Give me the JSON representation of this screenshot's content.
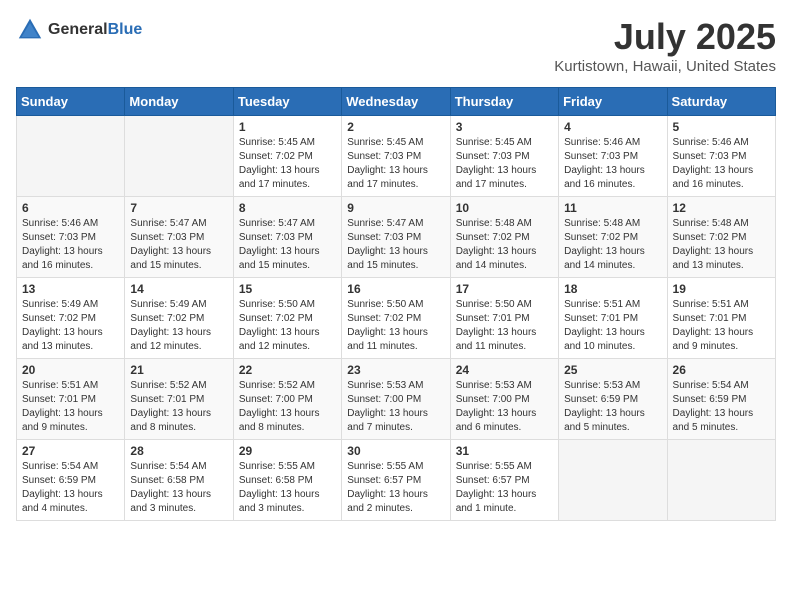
{
  "header": {
    "logo_general": "General",
    "logo_blue": "Blue",
    "month_year": "July 2025",
    "location": "Kurtistown, Hawaii, United States"
  },
  "days_of_week": [
    "Sunday",
    "Monday",
    "Tuesday",
    "Wednesday",
    "Thursday",
    "Friday",
    "Saturday"
  ],
  "weeks": [
    [
      {
        "day": "",
        "info": ""
      },
      {
        "day": "",
        "info": ""
      },
      {
        "day": "1",
        "info": "Sunrise: 5:45 AM\nSunset: 7:02 PM\nDaylight: 13 hours and 17 minutes."
      },
      {
        "day": "2",
        "info": "Sunrise: 5:45 AM\nSunset: 7:03 PM\nDaylight: 13 hours and 17 minutes."
      },
      {
        "day": "3",
        "info": "Sunrise: 5:45 AM\nSunset: 7:03 PM\nDaylight: 13 hours and 17 minutes."
      },
      {
        "day": "4",
        "info": "Sunrise: 5:46 AM\nSunset: 7:03 PM\nDaylight: 13 hours and 16 minutes."
      },
      {
        "day": "5",
        "info": "Sunrise: 5:46 AM\nSunset: 7:03 PM\nDaylight: 13 hours and 16 minutes."
      }
    ],
    [
      {
        "day": "6",
        "info": "Sunrise: 5:46 AM\nSunset: 7:03 PM\nDaylight: 13 hours and 16 minutes."
      },
      {
        "day": "7",
        "info": "Sunrise: 5:47 AM\nSunset: 7:03 PM\nDaylight: 13 hours and 15 minutes."
      },
      {
        "day": "8",
        "info": "Sunrise: 5:47 AM\nSunset: 7:03 PM\nDaylight: 13 hours and 15 minutes."
      },
      {
        "day": "9",
        "info": "Sunrise: 5:47 AM\nSunset: 7:03 PM\nDaylight: 13 hours and 15 minutes."
      },
      {
        "day": "10",
        "info": "Sunrise: 5:48 AM\nSunset: 7:02 PM\nDaylight: 13 hours and 14 minutes."
      },
      {
        "day": "11",
        "info": "Sunrise: 5:48 AM\nSunset: 7:02 PM\nDaylight: 13 hours and 14 minutes."
      },
      {
        "day": "12",
        "info": "Sunrise: 5:48 AM\nSunset: 7:02 PM\nDaylight: 13 hours and 13 minutes."
      }
    ],
    [
      {
        "day": "13",
        "info": "Sunrise: 5:49 AM\nSunset: 7:02 PM\nDaylight: 13 hours and 13 minutes."
      },
      {
        "day": "14",
        "info": "Sunrise: 5:49 AM\nSunset: 7:02 PM\nDaylight: 13 hours and 12 minutes."
      },
      {
        "day": "15",
        "info": "Sunrise: 5:50 AM\nSunset: 7:02 PM\nDaylight: 13 hours and 12 minutes."
      },
      {
        "day": "16",
        "info": "Sunrise: 5:50 AM\nSunset: 7:02 PM\nDaylight: 13 hours and 11 minutes."
      },
      {
        "day": "17",
        "info": "Sunrise: 5:50 AM\nSunset: 7:01 PM\nDaylight: 13 hours and 11 minutes."
      },
      {
        "day": "18",
        "info": "Sunrise: 5:51 AM\nSunset: 7:01 PM\nDaylight: 13 hours and 10 minutes."
      },
      {
        "day": "19",
        "info": "Sunrise: 5:51 AM\nSunset: 7:01 PM\nDaylight: 13 hours and 9 minutes."
      }
    ],
    [
      {
        "day": "20",
        "info": "Sunrise: 5:51 AM\nSunset: 7:01 PM\nDaylight: 13 hours and 9 minutes."
      },
      {
        "day": "21",
        "info": "Sunrise: 5:52 AM\nSunset: 7:01 PM\nDaylight: 13 hours and 8 minutes."
      },
      {
        "day": "22",
        "info": "Sunrise: 5:52 AM\nSunset: 7:00 PM\nDaylight: 13 hours and 8 minutes."
      },
      {
        "day": "23",
        "info": "Sunrise: 5:53 AM\nSunset: 7:00 PM\nDaylight: 13 hours and 7 minutes."
      },
      {
        "day": "24",
        "info": "Sunrise: 5:53 AM\nSunset: 7:00 PM\nDaylight: 13 hours and 6 minutes."
      },
      {
        "day": "25",
        "info": "Sunrise: 5:53 AM\nSunset: 6:59 PM\nDaylight: 13 hours and 5 minutes."
      },
      {
        "day": "26",
        "info": "Sunrise: 5:54 AM\nSunset: 6:59 PM\nDaylight: 13 hours and 5 minutes."
      }
    ],
    [
      {
        "day": "27",
        "info": "Sunrise: 5:54 AM\nSunset: 6:59 PM\nDaylight: 13 hours and 4 minutes."
      },
      {
        "day": "28",
        "info": "Sunrise: 5:54 AM\nSunset: 6:58 PM\nDaylight: 13 hours and 3 minutes."
      },
      {
        "day": "29",
        "info": "Sunrise: 5:55 AM\nSunset: 6:58 PM\nDaylight: 13 hours and 3 minutes."
      },
      {
        "day": "30",
        "info": "Sunrise: 5:55 AM\nSunset: 6:57 PM\nDaylight: 13 hours and 2 minutes."
      },
      {
        "day": "31",
        "info": "Sunrise: 5:55 AM\nSunset: 6:57 PM\nDaylight: 13 hours and 1 minute."
      },
      {
        "day": "",
        "info": ""
      },
      {
        "day": "",
        "info": ""
      }
    ]
  ]
}
